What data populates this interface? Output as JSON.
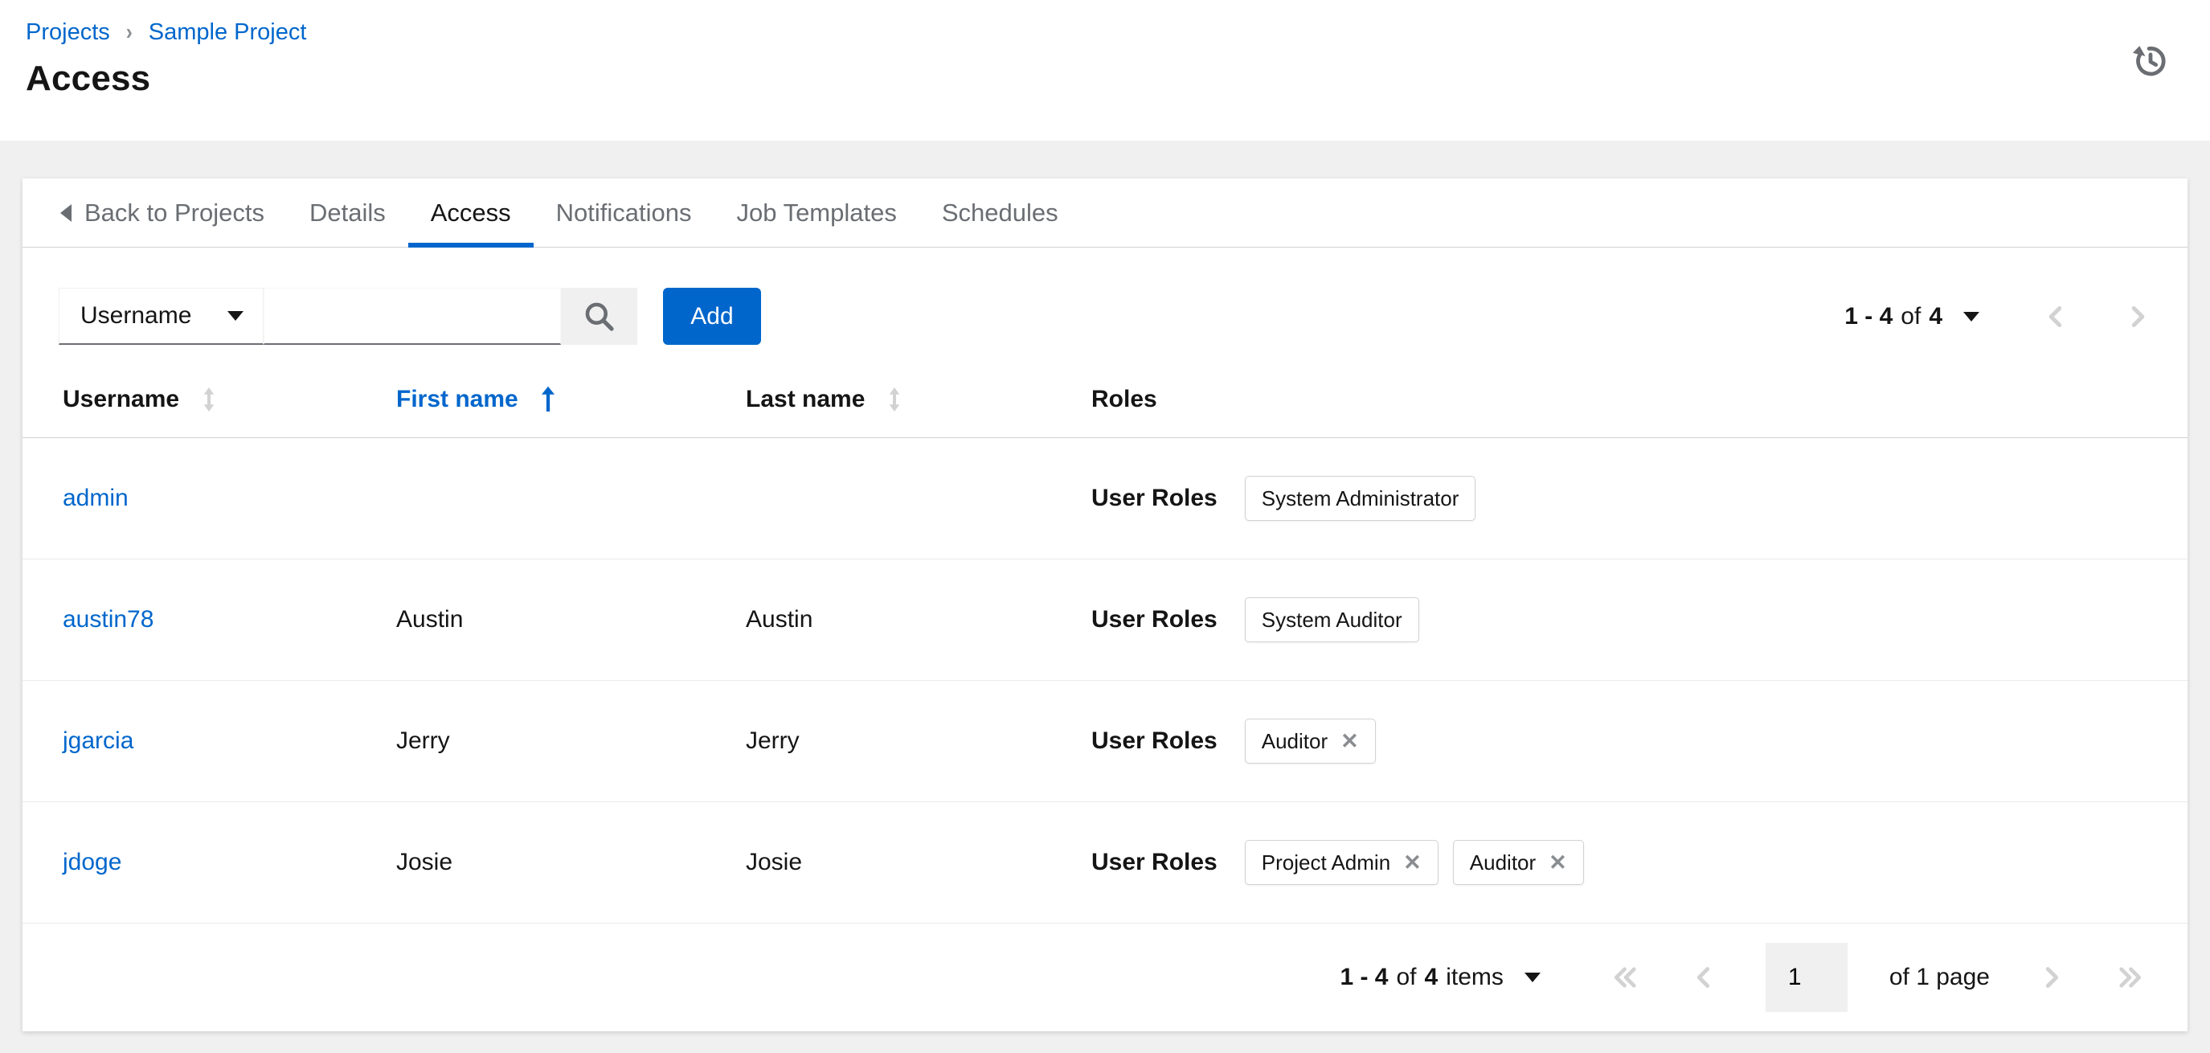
{
  "colors": {
    "primary_blue": "#0066cc",
    "link_blue": "#0066cc",
    "tab_inactive_gray": "#6a6e73",
    "border_gray": "#d2d2d2",
    "disabled_gray": "#d2d2d2",
    "page_background": "#f0f0f0"
  },
  "breadcrumb": {
    "projects": "Projects",
    "current": "Sample Project"
  },
  "page": {
    "title": "Access"
  },
  "icons": {
    "remove": "✕"
  },
  "tabs": {
    "back": "Back to Projects",
    "items": [
      {
        "label": "Details",
        "active": false
      },
      {
        "label": "Access",
        "active": true
      },
      {
        "label": "Notifications",
        "active": false
      },
      {
        "label": "Job Templates",
        "active": false
      },
      {
        "label": "Schedules",
        "active": false
      }
    ]
  },
  "toolbar": {
    "filter": {
      "selected": "Username"
    },
    "search": {
      "value": "",
      "placeholder": ""
    },
    "add": "Add",
    "pagination": {
      "range": "1 - 4",
      "of": "of",
      "total": "4"
    }
  },
  "table": {
    "headers": {
      "username": "Username",
      "first_name": "First name",
      "last_name": "Last name",
      "roles": "Roles"
    },
    "sort": {
      "active_column": "First name",
      "direction": "ascending"
    },
    "roles_label": "User Roles",
    "rows": [
      {
        "username": "admin",
        "first_name": "",
        "last_name": "",
        "roles": [
          {
            "name": "System Administrator",
            "removable": false
          }
        ]
      },
      {
        "username": "austin78",
        "first_name": "Austin",
        "last_name": "Austin",
        "roles": [
          {
            "name": "System Auditor",
            "removable": false
          }
        ]
      },
      {
        "username": "jgarcia",
        "first_name": "Jerry",
        "last_name": "Jerry",
        "roles": [
          {
            "name": "Auditor",
            "removable": true
          }
        ]
      },
      {
        "username": "jdoge",
        "first_name": "Josie",
        "last_name": "Josie",
        "roles": [
          {
            "name": "Project Admin",
            "removable": true
          },
          {
            "name": "Auditor",
            "removable": true
          }
        ]
      }
    ]
  },
  "footer": {
    "summary": {
      "range": "1 - 4",
      "of": "of",
      "total": "4",
      "items": "items"
    },
    "page_input": "1",
    "page_of": "of 1 page"
  }
}
